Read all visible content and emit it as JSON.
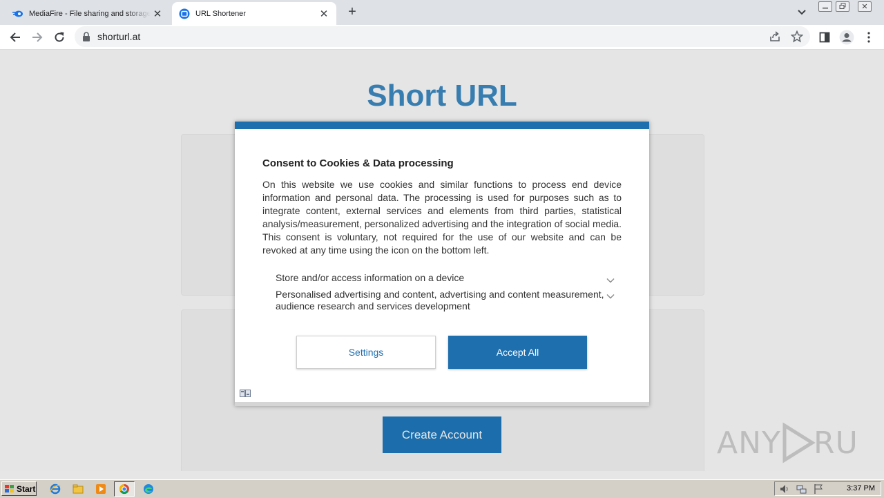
{
  "browser": {
    "tabs": [
      {
        "title": "MediaFire - File sharing and storage m",
        "active": false
      },
      {
        "title": "URL Shortener",
        "active": true
      }
    ],
    "address": "shorturl.at"
  },
  "page": {
    "title": "Short URL",
    "create_account_label": "Create Account"
  },
  "consent": {
    "heading": "Consent to Cookies & Data processing",
    "body": "On this website we use cookies and similar functions to process end device information and personal data. The processing is used for purposes such as to integrate content, external services and elements from third parties, statistical analysis/measurement, personalized advertising and the integration of social media. This consent is voluntary, not required for the use of our website and can be revoked at any time using the icon on the bottom left.",
    "purposes": [
      {
        "label": "Store and/or access information on a device"
      },
      {
        "label": "Personalised advertising and content, advertising and content measurement, audience research and services development"
      }
    ],
    "settings_label": "Settings",
    "accept_label": "Accept All"
  },
  "watermark": "ANY RUN",
  "taskbar": {
    "start_label": "Start",
    "clock": "3:37 PM"
  },
  "colors": {
    "accent": "#1e6fae",
    "page_title": "#3f8cc4",
    "tabstrip": "#dee1e6",
    "taskbar": "#d4d0c8"
  }
}
